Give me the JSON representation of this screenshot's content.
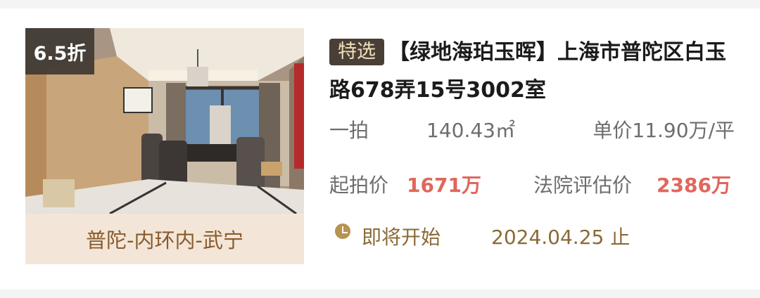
{
  "listing": {
    "discount": "6.5折",
    "location": "普陀-内环内-武宁",
    "tag": "特选",
    "title": "【绿地海珀玉晖】上海市普陀区白玉路678弄15号3002室",
    "auction_round": "一拍",
    "area": "140.43㎡",
    "unit_price": "单价11.90万/平",
    "start_price_label": "起拍价",
    "start_price_value": "1671万",
    "appraisal_label": "法院评估价",
    "appraisal_value": "2386万",
    "status_icon": "clock-icon",
    "status": "即将开始",
    "end_date": "2024.04.25 止"
  },
  "colors": {
    "accent_red": "#e0675c",
    "tag_bg": "#4a3f37",
    "status_gold": "#8a6a36",
    "location_bg": "#f3e6d8"
  }
}
